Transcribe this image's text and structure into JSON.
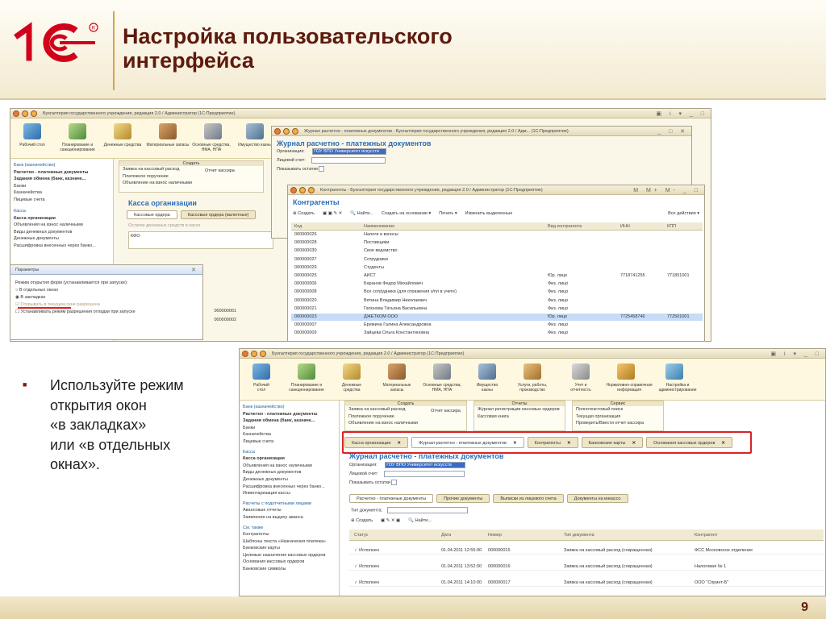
{
  "slide": {
    "title": "Настройка пользовательского\nинтерфейса",
    "page_number": "9",
    "bullet_text": "Используйте режим\nоткрытия окон\n«в закладках»\nили «в отдельных\nокнах».",
    "brand_color": "#d0021b",
    "title_color": "#5e1a0e"
  },
  "top_screenshot": {
    "main_title": "Бухгалтерия государственного учреждения, редакция 2.0 / Администратор (1С:Предприятие)",
    "sections": [
      "Рабочий\nстол",
      "Планирование и\nсанкционирование",
      "Денежные\nсредства",
      "Материальные\nзапасы",
      "Основные средства,\nНМА, НПА",
      "Имущество\nказны"
    ],
    "sidebar": [
      "Банк (казначейство)",
      "Расчетно - платежные документы",
      "Задания обмена (банк, казначе...",
      "Банки",
      "Казначейства",
      "Пицевые счета",
      "Касса",
      "Касса организации",
      "Объявления на взнос наличными",
      "Виды денежных документов",
      "Денежные документы",
      "Расшифровка внесенных через банко..."
    ],
    "create_header": "Создать",
    "create_items": [
      "Заявка на кассовый расход",
      "Платежное поручение",
      "Объявление на взнос наличными"
    ],
    "create_right": "Отчет кассира",
    "kassa": {
      "title": "Касса организации",
      "tabs": [
        "Кассовые ордера",
        "Кассовые ордера (валютные)"
      ],
      "subtitle": "Остатки денежных средств в кассе",
      "kfo": "КФО"
    },
    "journal": {
      "window_title": "Журнал расчетно - платежных документов - Бухгалтерия государственного учреждения, редакция 2.0 / Адм... (1С:Предприятие)",
      "title": "Журнал расчетно - платежных документов",
      "org_label": "Организация:",
      "org_value": "ГОУ ВПО Университет искусств",
      "account_label": "Лицевой счет:",
      "show_balance_label": "Показывать остатки"
    },
    "params": {
      "title": "Параметры",
      "label": "Режим открытия форм (устанавливается при запуске):",
      "option1": "В отдельных окнах",
      "option2": "В закладках",
      "check1": "Открывать в текущем окне разрешена",
      "check2": "Устанавливать режим разрешения отладки при запуске"
    },
    "contractors": {
      "window_title": "Контрагенты - Бухгалтерия государственного учреждения, редакция 2.0 / Администратор (1С:Предприятие)",
      "title": "Контрагенты",
      "toolbar": [
        "Создать",
        "Найти...",
        "Создать на основании",
        "Печать",
        "Изменить выделенные"
      ],
      "all_actions": "Все действия",
      "columns": [
        "Код",
        "Наименование",
        "Вид контрагента",
        "ИНН",
        "КПП"
      ],
      "rows": [
        [
          "000000026",
          "Налоги и взносы",
          "",
          "",
          ""
        ],
        [
          "000000028",
          "Поставщики",
          "",
          "",
          ""
        ],
        [
          "000000030",
          "Свое ведомство",
          "",
          "",
          ""
        ],
        [
          "000000027",
          "Сотрудники",
          "",
          "",
          ""
        ],
        [
          "000000029",
          "Студенты",
          "",
          "",
          ""
        ],
        [
          "000000025",
          "АИСТ",
          "Юр. лицо",
          "7718741255",
          "771801001"
        ],
        [
          "000000006",
          "Баранов Федор Михайлович",
          "Физ. лицо",
          "",
          ""
        ],
        [
          "000000008",
          "Все сотрудники (для отражения з/пл в учете)",
          "Физ. лицо",
          "",
          ""
        ],
        [
          "000000020",
          "Вятина Владимир Николаевич",
          "Физ. лицо",
          "",
          ""
        ],
        [
          "000000021",
          "Гапонова Татьяна Васильевна",
          "Физ. лицо",
          "",
          ""
        ],
        [
          "000000023",
          "ДЖЕТКОМ ООО",
          "Юр. лицо",
          "7725458746",
          "772501001"
        ],
        [
          "000000007",
          "Еремина Галина Александровна",
          "Физ. лицо",
          "",
          ""
        ],
        [
          "000000009",
          "Зайцева Ольга Константиновна",
          "Физ. лицо",
          "",
          ""
        ]
      ],
      "selected_row": 10
    },
    "background_rows": [
      "000000001",
      "000000002"
    ]
  },
  "bottom_screenshot": {
    "main_title": "Бухгалтерия государственного учреждения, редакция 2.0 / Администратор (1С:Предприятие)",
    "sections": [
      "Рабочий\nстол",
      "Планирование и\nсанкционирование",
      "Денежные\nсредства",
      "Материальные\nзапасы",
      "Основные средства,\nНМА, НПА",
      "Имущество\nказны",
      "Услуги, работы,\nпроизводство",
      "Учет и\nотчетность",
      "Нормативно-справочная\nинформация",
      "Настройка и\nадминистрирование"
    ],
    "create_header": "Создать",
    "create_items": [
      "Заявка на кассовый расход",
      "Платежное поручение",
      "Объявление на взнос наличными"
    ],
    "create_right": "Отчет кассира",
    "reports_header": "Отчеты",
    "reports_items": [
      "Журнал регистрации кассовых ордеров",
      "Кассовая книга"
    ],
    "service_header": "Сервис",
    "service_items": [
      "Полнотекстовый поиск",
      "Текущая организация",
      "Проверить/Ввести отчет кассира"
    ],
    "sidebar": [
      "Банк (казначейство)",
      "Расчетно - платежные документы",
      "Задания обмена (банк, казначе...",
      "Банки",
      "Казначейства",
      "Лицевые счета",
      "",
      "Касса",
      "Касса организации",
      "Объявления на взнос наличными",
      "Виды денежных документов",
      "Денежные документы",
      "Расшифровка внесенных через банко...",
      "Инвентаризация кассы",
      "",
      "Расчеты с подотчетными лицами",
      "Авансовые отчеты",
      "Заявления на выдачу аванса",
      "",
      "См. также",
      "Контрагенты",
      "Шаблоны текста «Назначения платежа»",
      "Банковские карты",
      "Целевые назначения кассовых ордеров",
      "Основания кассовых ордеров",
      "Банковские символы"
    ],
    "open_tabs": [
      "Касса организации",
      "Журнал расчетно - платежных документов",
      "Контрагенты",
      "Банковские карты",
      "Основания кассовых ордеров"
    ],
    "active_tab": 1,
    "journal": {
      "title": "Журнал расчетно - платежных документов",
      "org_label": "Организация:",
      "org_value": "ГОУ ВПО Университет искусств",
      "account_label": "Лицевой счет:",
      "show_balance_label": "Показывать остатки",
      "doc_tabs": [
        "Расчетно - платежные документы",
        "Прочие документы",
        "Выписки из лицевого счета",
        "Документы на инкассо"
      ],
      "doc_type_label": "Тип документа:",
      "toolbar": [
        "Создать",
        "Найти..."
      ],
      "columns": [
        "Статус",
        "Дата",
        "Номер",
        "Тип документа",
        "Контрагент"
      ],
      "rows": [
        [
          "Исполнен",
          "01.04.2011 12:55:00",
          "000000015",
          "Заявка на кассовый расход (сокращенная)",
          "ФСС Московское отделение"
        ],
        [
          "Исполнен",
          "01.04.2011 13:52:00",
          "000000016",
          "Заявка на кассовый расход (сокращенная)",
          "Налоговая № 1"
        ],
        [
          "Исполнен",
          "01.04.2011 14:10:00",
          "000000017",
          "Заявка на кассовый расход (сокращенная)",
          "ООО \"Спринт-Б\""
        ]
      ]
    }
  }
}
